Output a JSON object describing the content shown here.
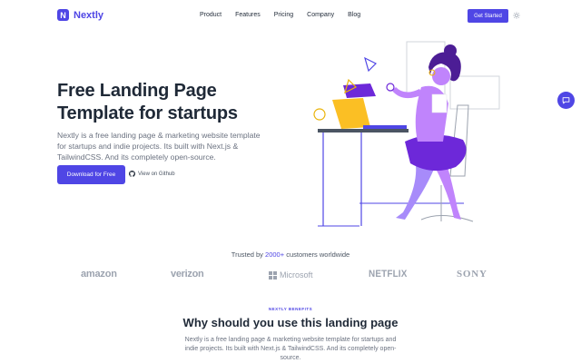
{
  "brand": {
    "name": "Nextly",
    "logo_letter": "N",
    "color": "#4f46e5"
  },
  "nav": {
    "items": [
      "Product",
      "Features",
      "Pricing",
      "Company",
      "Blog"
    ],
    "cta_label": "Get Started",
    "theme_icon": "sun-icon"
  },
  "hero": {
    "title_line1": "Free Landing Page",
    "title_line2": "Template for startups",
    "description": "Nextly is a free landing page & marketing website template for startups and indie projects. Its built with Next.js & TailwindCSS. And its completely open-source.",
    "primary_label": "Download for Free",
    "github_label": "View on Github"
  },
  "trusted": {
    "prefix": "Trusted by ",
    "highlight": "2000+",
    "suffix": " customers worldwide",
    "logos": [
      "amazon",
      "verizon",
      "Microsoft",
      "NETFLIX",
      "SONY"
    ]
  },
  "benefits": {
    "kicker": "NEXTLY BENEFITS",
    "title": "Why should you use this landing page",
    "description": "Nextly is a free landing page & marketing website template for startups and indie projects. Its built with Next.js & TailwindCSS. And its completely open-source."
  },
  "chat": {
    "icon": "chat-bubble-icon"
  }
}
